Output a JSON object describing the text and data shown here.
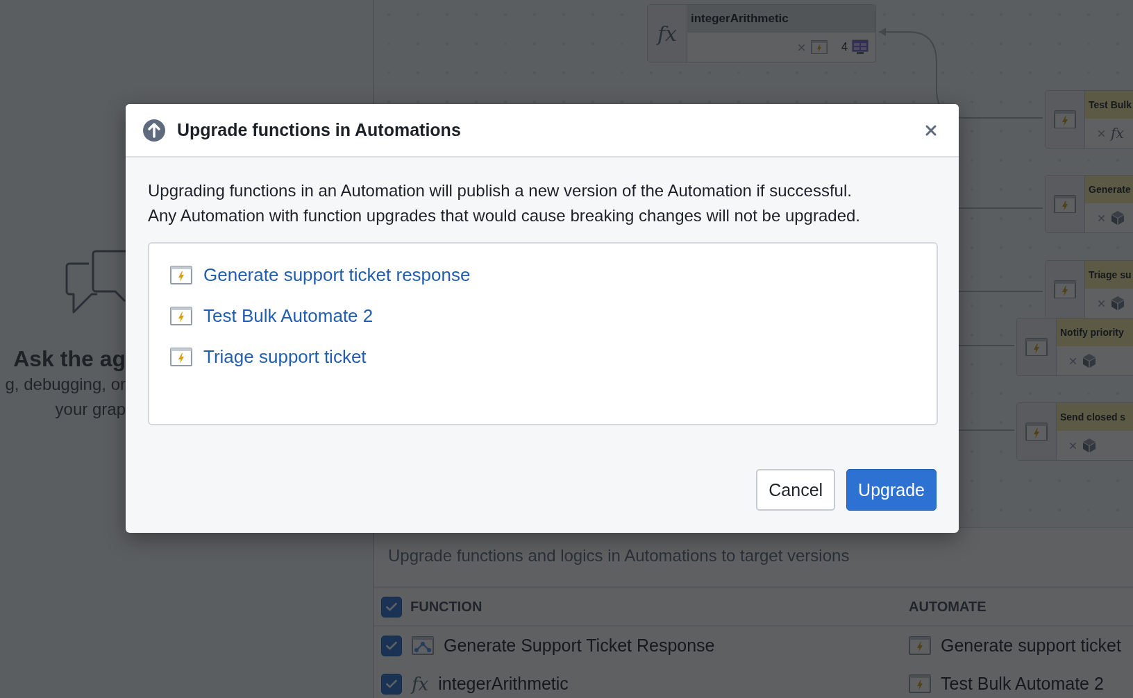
{
  "sidebar": {
    "empty_state": {
      "title": "Ask the ag",
      "lines": [
        "g, debugging, or",
        "your grap"
      ]
    }
  },
  "graph": {
    "nodes": [
      {
        "kind": "function",
        "glyph": "fx",
        "title": "integerArithmetic",
        "count": "4"
      },
      {
        "kind": "automation",
        "title": "Test Bulk",
        "output": {
          "kind": "function",
          "glyph": "fx"
        }
      },
      {
        "kind": "automation",
        "title": "Generate",
        "output": {
          "kind": "object"
        }
      },
      {
        "kind": "automation",
        "title": "Triage su",
        "output": {
          "kind": "object"
        }
      },
      {
        "kind": "automation",
        "title": "Notify priority",
        "output": {
          "kind": "object"
        }
      },
      {
        "kind": "automation",
        "title": "Send closed s",
        "output": {
          "kind": "object"
        }
      }
    ]
  },
  "panel": {
    "description": "Upgrade functions and logics in Automations to target versions",
    "select_all": {
      "checked": true
    },
    "columns": [
      "FUNCTION",
      "AUTOMATE"
    ],
    "rows": [
      {
        "checked": true,
        "function": {
          "kind": "logic",
          "name": "Generate Support Ticket Response"
        },
        "automate": "Generate support ticket"
      },
      {
        "checked": true,
        "function": {
          "kind": "function",
          "glyph": "fx",
          "name": "integerArithmetic"
        },
        "automate": "Test Bulk Automate 2"
      }
    ]
  },
  "dialog": {
    "title": "Upgrade functions in Automations",
    "message_lines": [
      "Upgrading functions in an Automation will publish a new version of the Automation if successful.",
      "Any Automation with function upgrades that would cause breaking changes will not be upgraded."
    ],
    "items": [
      "Generate support ticket response",
      "Test Bulk Automate 2",
      "Triage support ticket"
    ],
    "buttons": [
      {
        "label": "Cancel",
        "kind": "secondary"
      },
      {
        "label": "Upgrade",
        "kind": "primary"
      }
    ]
  }
}
